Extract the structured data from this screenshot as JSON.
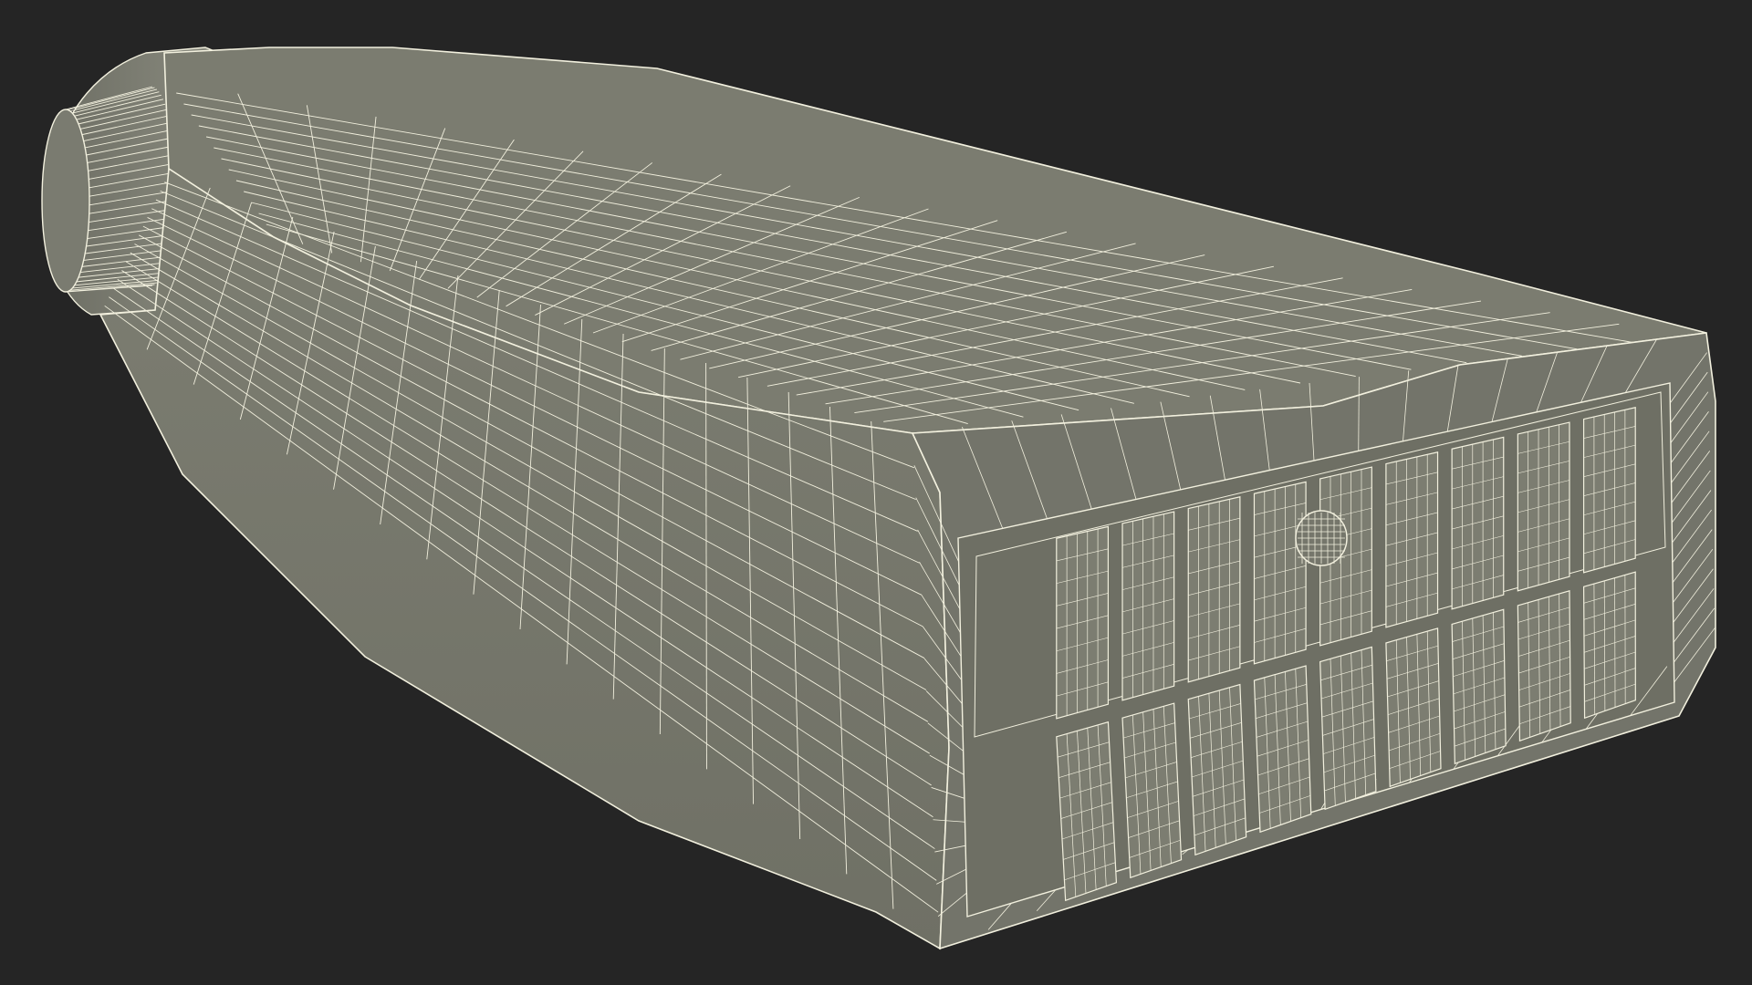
{
  "scene": {
    "subject": "bottle-wireframe",
    "render_style": "wireframe",
    "colors": {
      "background": "#252525",
      "shell": "#7a7b6f",
      "shell_dark": "#6a6b60",
      "shell_light": "#85867a",
      "wire": "#f2f0de"
    }
  }
}
